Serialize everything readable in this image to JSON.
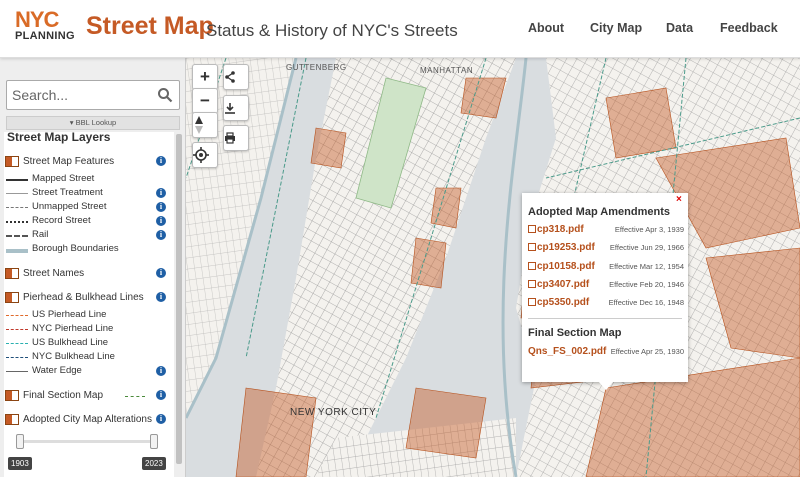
{
  "header": {
    "logo_line1": "NYC",
    "logo_line2": "PLANNING",
    "title": "Street Map",
    "subtitle": "Status & History of NYC's Streets",
    "nav": [
      {
        "label": "About"
      },
      {
        "label": "City Map"
      },
      {
        "label": "Data"
      },
      {
        "label": "Feedback"
      }
    ]
  },
  "sidebar": {
    "search_placeholder": "Search...",
    "bbl_lookup": "▾ BBL Lookup",
    "layers_title": "Street Map Layers",
    "groups": {
      "features": "Street Map Features",
      "mapped": "Mapped Street",
      "treatment": "Street Treatment",
      "unmapped": "Unmapped Street",
      "record": "Record Street",
      "rail": "Rail",
      "borough": "Borough Boundaries",
      "names": "Street Names",
      "pierhead": "Pierhead & Bulkhead Lines",
      "us_pier": "US Pierhead Line",
      "nyc_pier": "NYC Pierhead Line",
      "us_bulk": "US Bulkhead Line",
      "nyc_bulk": "NYC Bulkhead Line",
      "water": "Water Edge",
      "final_section": "Final Section Map",
      "alterations": "Adopted City Map Alterations"
    },
    "slider": {
      "min_label": "1903",
      "max_label": "2023",
      "range": [
        1903,
        2023
      ]
    }
  },
  "map": {
    "labels": {
      "guttenberg": "GUTTENBERG",
      "manhattan": "MANHATTAN",
      "new_york_city": "NEW YORK CITY"
    },
    "controls": {
      "zoom_in": "+",
      "zoom_out": "−"
    }
  },
  "popup": {
    "amendments_heading": "Adopted Map Amendments",
    "amendments": [
      {
        "file": "cp318.pdf",
        "date": "Effective Apr 3, 1939"
      },
      {
        "file": "cp19253.pdf",
        "date": "Effective Jun 29, 1966"
      },
      {
        "file": "cp10158.pdf",
        "date": "Effective Mar 12, 1954"
      },
      {
        "file": "cp3407.pdf",
        "date": "Effective Feb 20, 1946"
      },
      {
        "file": "cp5350.pdf",
        "date": "Effective Dec 16, 1948"
      }
    ],
    "final_heading": "Final Section Map",
    "final_file": "Qns_FS_002.pdf",
    "final_date": "Effective Apr 25, 1930",
    "close": "×"
  },
  "colors": {
    "accent": "#c55a25",
    "info": "#1f5fa5",
    "water": "#d9dde0"
  }
}
